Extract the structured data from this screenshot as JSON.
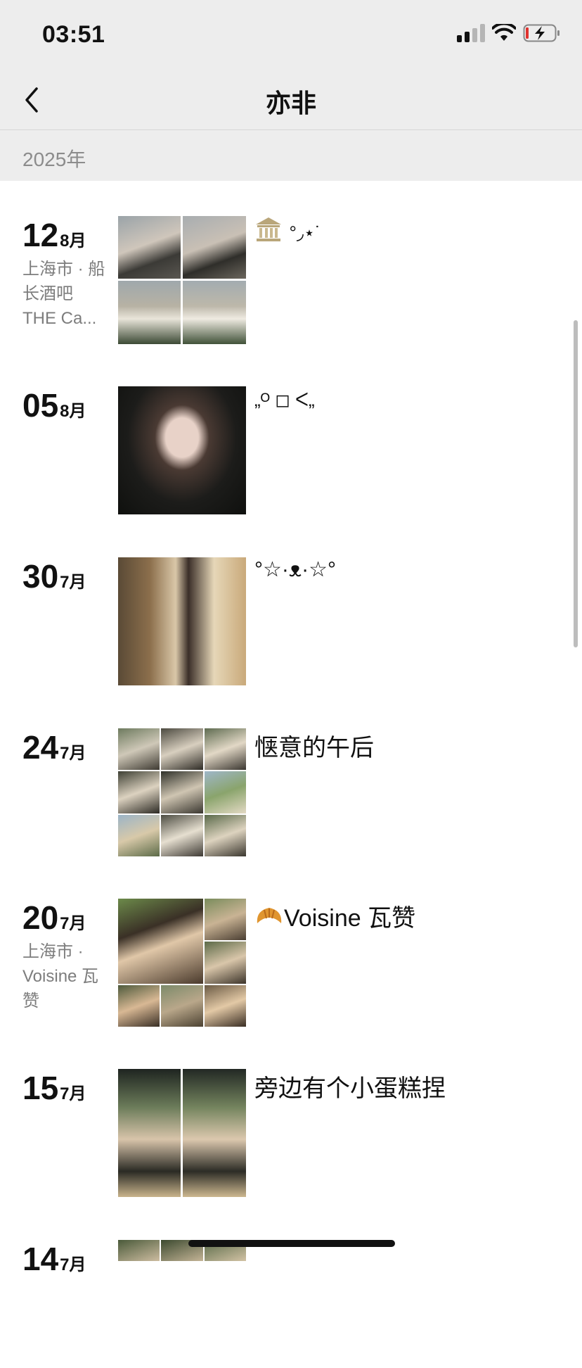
{
  "status_bar": {
    "time": "03:51"
  },
  "nav": {
    "title": "亦非",
    "back_icon": "chevron-left-icon"
  },
  "year_header": "2025年",
  "entries": [
    {
      "day": "12",
      "month": "8月",
      "location": "上海市 · 船长酒吧 THE Ca...",
      "caption": "°◞⋆˙",
      "caption_icon": "museum-icon",
      "photo_count": 4
    },
    {
      "day": "05",
      "month": "8月",
      "location": "",
      "caption": "„ᴼ ◻ ᐸ„",
      "photo_count": 1
    },
    {
      "day": "30",
      "month": "7月",
      "location": "",
      "caption": "°☆·ᴥ·☆°",
      "photo_count": 1
    },
    {
      "day": "24",
      "month": "7月",
      "location": "",
      "caption": "惬意的午后",
      "photo_count": 9
    },
    {
      "day": "20",
      "month": "7月",
      "location": "上海市 · Voisine 瓦赞",
      "caption": "Voisine 瓦赞",
      "caption_icon": "croissant-icon",
      "photo_count": 7
    },
    {
      "day": "15",
      "month": "7月",
      "location": "",
      "caption": "旁边有个小蛋糕捏",
      "photo_count": 2
    },
    {
      "day": "14",
      "month": "7月",
      "location": "",
      "caption": "",
      "photo_count": 3
    }
  ],
  "colors": {
    "header_bg": "#ededed",
    "text_primary": "#111111",
    "text_secondary": "#7d7d7d"
  }
}
